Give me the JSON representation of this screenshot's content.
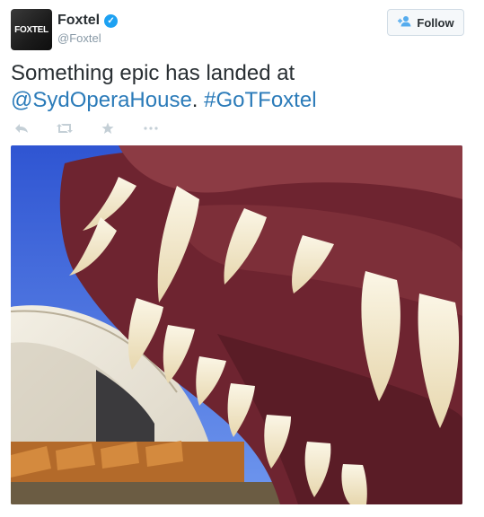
{
  "tweet": {
    "author": {
      "display_name": "Foxtel",
      "handle": "@Foxtel",
      "avatar_text": "FOXTEL",
      "verified": true
    },
    "follow_label": "Follow",
    "text_plain": "Something epic has landed at ",
    "mention": "@SydOperaHouse",
    "separator": ". ",
    "hashtag": "#GoTFoxtel",
    "actions": [
      "reply-icon",
      "retweet-icon",
      "favorite-icon",
      "more-icon"
    ],
    "colors": {
      "link": "#2b7bb9",
      "verified": "#1da1f2",
      "sky": "#3a63d8",
      "dragon": "#7a2c36"
    }
  }
}
